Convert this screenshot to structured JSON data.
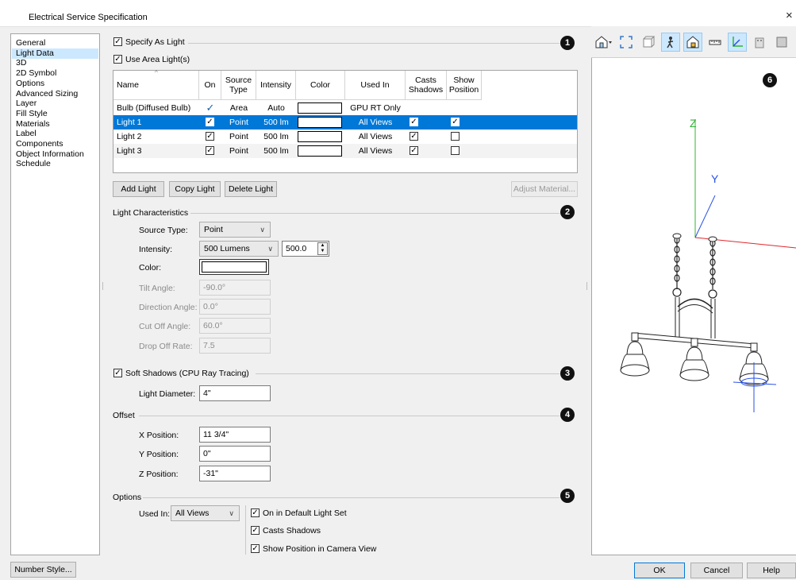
{
  "window": {
    "title": "Electrical Service Specification",
    "close_glyph": "×"
  },
  "categories": [
    {
      "label": "General",
      "selected": false
    },
    {
      "label": "Light Data",
      "selected": true
    },
    {
      "label": "3D",
      "selected": false
    },
    {
      "label": "2D Symbol",
      "selected": false
    },
    {
      "label": "Options",
      "selected": false
    },
    {
      "label": "Advanced Sizing",
      "selected": false
    },
    {
      "label": "Layer",
      "selected": false
    },
    {
      "label": "Fill Style",
      "selected": false
    },
    {
      "label": "Materials",
      "selected": false
    },
    {
      "label": "Label",
      "selected": false
    },
    {
      "label": "Components",
      "selected": false
    },
    {
      "label": "Object Information",
      "selected": false
    },
    {
      "label": "Schedule",
      "selected": false
    }
  ],
  "specify_as_light": {
    "label": "Specify As Light",
    "checked": true
  },
  "use_area_lights": {
    "label": "Use Area Light(s)",
    "checked": true
  },
  "badges": [
    "1",
    "2",
    "3",
    "4",
    "5",
    "6"
  ],
  "table": {
    "headers": {
      "name": "Name",
      "on": "On",
      "source_type_1": "Source",
      "source_type_2": "Type",
      "intensity": "Intensity",
      "color": "Color",
      "used_in": "Used In",
      "casts_1": "Casts",
      "casts_2": "Shadows",
      "show_1": "Show",
      "show_2": "Position"
    },
    "rows": [
      {
        "name": "Bulb (Diffused Bulb)",
        "on": "✓",
        "source": "Area",
        "intensity": "Auto",
        "used_in": "GPU RT Only",
        "casts": null,
        "show": null,
        "selected": false
      },
      {
        "name": "Light 1",
        "on": true,
        "source": "Point",
        "intensity": "500 lm",
        "used_in": "All Views",
        "casts": true,
        "show": true,
        "selected": true
      },
      {
        "name": "Light 2",
        "on": true,
        "source": "Point",
        "intensity": "500 lm",
        "used_in": "All Views",
        "casts": true,
        "show": false,
        "selected": false
      },
      {
        "name": "Light 3",
        "on": true,
        "source": "Point",
        "intensity": "500 lm",
        "used_in": "All Views",
        "casts": true,
        "show": false,
        "selected": false
      }
    ]
  },
  "buttons": {
    "add_light": "Add Light",
    "copy_light": "Copy Light",
    "delete_light": "Delete Light",
    "adjust_material": "Adjust Material...",
    "number_style": "Number Style...",
    "ok": "OK",
    "cancel": "Cancel",
    "help": "Help"
  },
  "light_characteristics": {
    "heading": "Light Characteristics",
    "source_type_label": "Source Type:",
    "source_type_value": "Point",
    "intensity_label": "Intensity:",
    "intensity_unit_value": "500 Lumens",
    "intensity_number": "500.0",
    "color_label": "Color:",
    "color_value": "#ffffff",
    "tilt_label": "Tilt Angle:",
    "tilt_value": "-90.0°",
    "direction_label": "Direction Angle:",
    "direction_value": "0.0°",
    "cutoff_label": "Cut Off Angle:",
    "cutoff_value": "60.0°",
    "dropoff_label": "Drop Off Rate:",
    "dropoff_value": "7.5"
  },
  "soft_shadows": {
    "label": "Soft Shadows (CPU Ray Tracing)",
    "checked": true,
    "diameter_label": "Light Diameter:",
    "diameter_value": "4\""
  },
  "offset": {
    "heading": "Offset",
    "x_label": "X Position:",
    "x_value": "11 3/4\"",
    "y_label": "Y Position:",
    "y_value": "0\"",
    "z_label": "Z Position:",
    "z_value": "-31\""
  },
  "options": {
    "heading": "Options",
    "used_in_label": "Used In:",
    "used_in_value": "All Views",
    "on_default": {
      "label": "On in Default Light Set",
      "checked": true
    },
    "casts_shadows": {
      "label": "Casts Shadows",
      "checked": true
    },
    "show_position": {
      "label": "Show Position in Camera View",
      "checked": true
    }
  },
  "preview": {
    "axis_z": "Z",
    "axis_y": "Y"
  },
  "colors": {
    "accent": "#0078d7",
    "selection_light": "#cce8ff",
    "axis_x": "#e0282d",
    "axis_y": "#2851e6",
    "axis_z": "#2fb532"
  }
}
